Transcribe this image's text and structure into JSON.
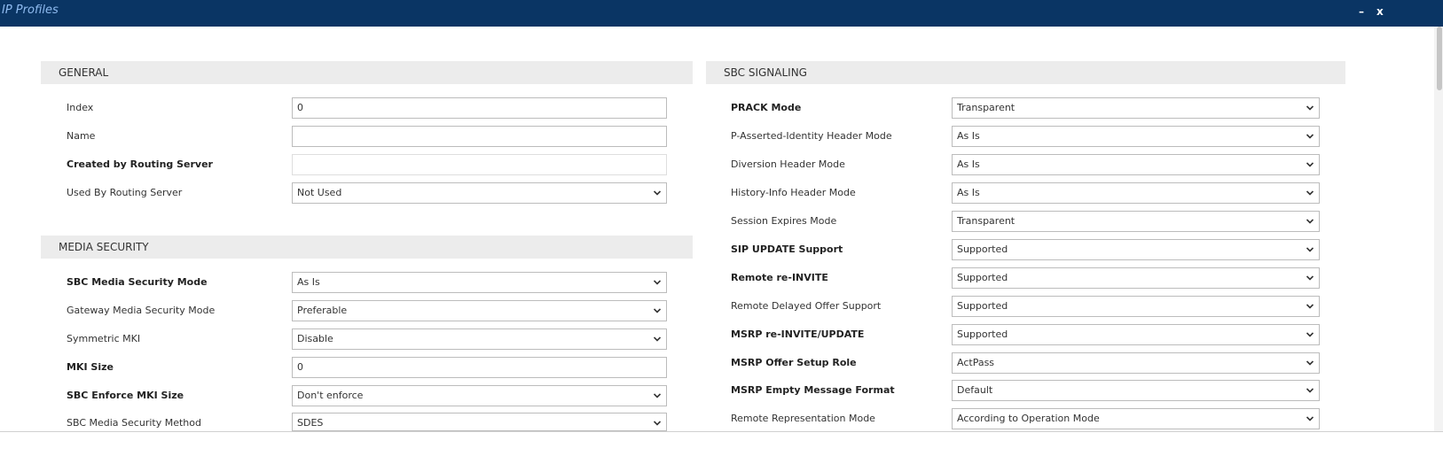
{
  "window": {
    "title": "IP Profiles",
    "minimize_label": "–",
    "close_label": "x"
  },
  "general": {
    "header": "GENERAL",
    "rows": [
      {
        "label": "Index",
        "value": ""
      },
      {
        "label": "Name",
        "value": ""
      },
      {
        "label": "Created by Routing Server",
        "value": ""
      },
      {
        "label": "Used By Routing Server",
        "value": "Not Used"
      }
    ],
    "index_value": "0"
  },
  "media_security": {
    "header": "MEDIA SECURITY",
    "rows": [
      {
        "label": "SBC Media Security Mode",
        "value": "As Is"
      },
      {
        "label": "Gateway Media Security Mode",
        "value": "Preferable"
      },
      {
        "label": "Symmetric MKI",
        "value": "Disable"
      },
      {
        "label": "MKI Size",
        "value": "0"
      },
      {
        "label": "SBC Enforce MKI Size",
        "value": "Don't enforce"
      },
      {
        "label": "SBC Media Security Method",
        "value": "SDES"
      }
    ]
  },
  "sbc_signaling": {
    "header": "SBC SIGNALING",
    "rows": [
      {
        "label": "PRACK Mode",
        "value": "Transparent"
      },
      {
        "label": "P-Asserted-Identity Header Mode",
        "value": "As Is"
      },
      {
        "label": "Diversion Header Mode",
        "value": "As Is"
      },
      {
        "label": "History-Info Header Mode",
        "value": "As Is"
      },
      {
        "label": "Session Expires Mode",
        "value": "Transparent"
      },
      {
        "label": "SIP UPDATE Support",
        "value": "Supported"
      },
      {
        "label": "Remote re-INVITE",
        "value": "Supported"
      },
      {
        "label": "Remote Delayed Offer Support",
        "value": "Supported"
      },
      {
        "label": "MSRP re-INVITE/UPDATE",
        "value": "Supported"
      },
      {
        "label": "MSRP Offer Setup Role",
        "value": "ActPass"
      },
      {
        "label": "MSRP Empty Message Format",
        "value": "Default"
      },
      {
        "label": "Remote Representation Mode",
        "value": "According to Operation Mode"
      }
    ]
  },
  "icons": {
    "dropdown": "chevron-down-icon"
  },
  "colors": {
    "titlebar": "#0a3564",
    "title_text": "#8fbbf0",
    "section_header": "#ececec"
  }
}
